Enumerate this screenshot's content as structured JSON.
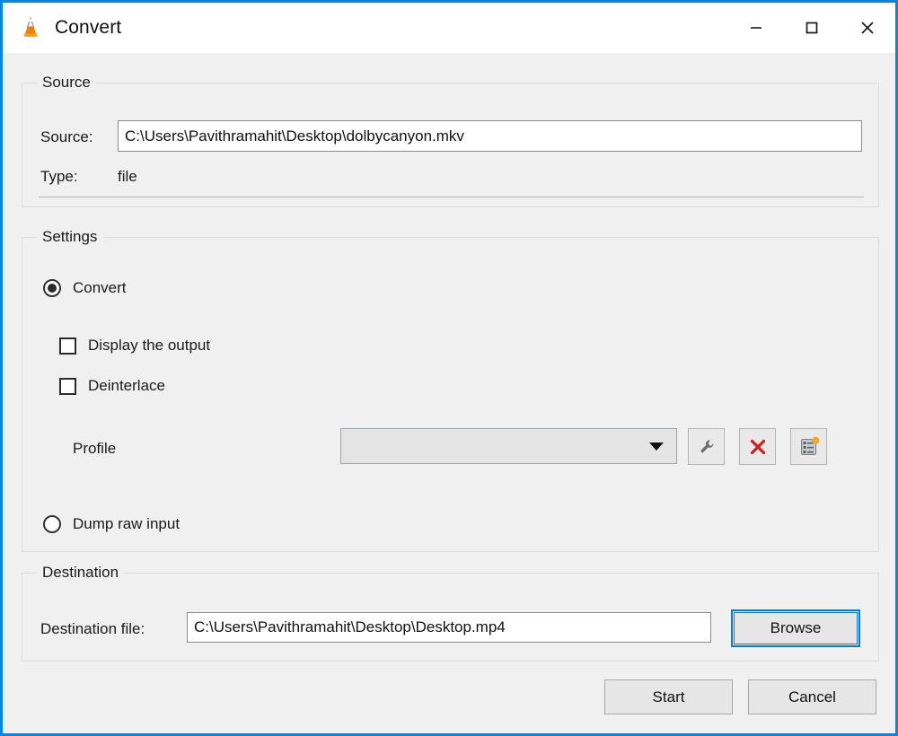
{
  "window": {
    "title": "Convert",
    "app_icon": "vlc-cone-icon",
    "accent_border": "#0a84e0",
    "body_bg": "#f0f0f0",
    "titlebar_bg": "#ffffff",
    "controls": {
      "minimize": "minimize-icon",
      "maximize": "maximize-icon",
      "close": "close-icon"
    }
  },
  "source": {
    "group_title": "Source",
    "source_label": "Source:",
    "source_value": "C:\\Users\\Pavithramahit\\Desktop\\dolbycanyon.mkv",
    "source_placeholder": "",
    "type_label": "Type:",
    "type_value": "file"
  },
  "settings": {
    "group_title": "Settings",
    "convert_radio": {
      "label": "Convert",
      "selected": true
    },
    "display_output_checkbox": {
      "label": "Display the output",
      "checked": false
    },
    "deinterlace_checkbox": {
      "label": "Deinterlace",
      "checked": false
    },
    "profile": {
      "label": "Profile",
      "selected_value": "",
      "options": [],
      "edit_button_icon": "wrench-icon",
      "delete_button_icon": "red-x-icon",
      "new_button_icon": "new-profile-list-icon",
      "edit_icon_color": "#6e6e6e",
      "delete_icon_color": "#d01e1e",
      "new_badge_color": "#f5a623"
    },
    "dump_raw_radio": {
      "label": "Dump raw input",
      "selected": false
    }
  },
  "destination": {
    "group_title": "Destination",
    "file_label": "Destination file:",
    "file_value": "C:\\Users\\Pavithramahit\\Desktop\\Desktop.mp4",
    "file_placeholder": "",
    "browse_label": "Browse",
    "browse_focused": true
  },
  "actions": {
    "start_label": "Start",
    "cancel_label": "Cancel"
  }
}
